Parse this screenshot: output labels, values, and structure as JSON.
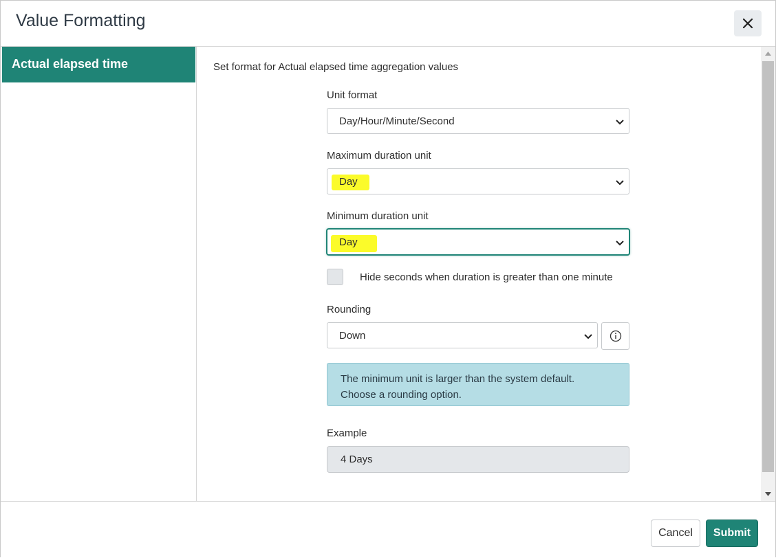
{
  "modal": {
    "title": "Value Formatting",
    "close_icon": "close-icon"
  },
  "sidebar": {
    "items": [
      {
        "label": "Actual elapsed time",
        "active": true
      }
    ]
  },
  "main": {
    "description": "Set format for Actual elapsed time aggregation values",
    "unit_format": {
      "label": "Unit format",
      "value": "Day/Hour/Minute/Second"
    },
    "max_unit": {
      "label": "Maximum duration unit",
      "value": "Day"
    },
    "min_unit": {
      "label": "Minimum duration unit",
      "value": "Day"
    },
    "hide_seconds": {
      "label": "Hide seconds when duration is greater than one minute",
      "checked": false
    },
    "rounding": {
      "label": "Rounding",
      "value": "Down",
      "info_icon": "info-icon"
    },
    "alert": {
      "line1": "The minimum unit is larger than the system default.",
      "line2": "Choose a rounding option."
    },
    "example": {
      "label": "Example",
      "value": "4 Days"
    }
  },
  "footer": {
    "cancel_label": "Cancel",
    "submit_label": "Submit"
  },
  "colors": {
    "accent": "#1f8476",
    "highlight": "#fbfb2a",
    "alert_bg": "#b5dde5"
  }
}
